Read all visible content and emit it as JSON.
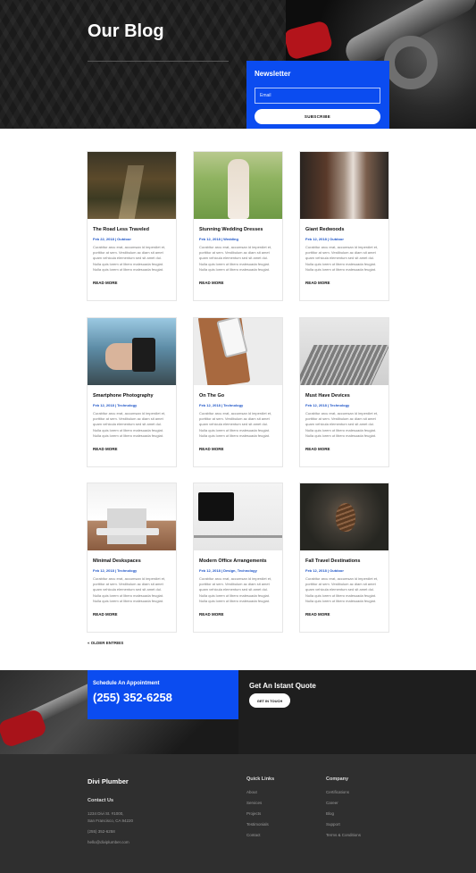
{
  "hero": {
    "title": "Our Blog"
  },
  "newsletter": {
    "title": "Newsletter",
    "email_placeholder": "Email",
    "subscribe_label": "SUBSCRIBE"
  },
  "posts": [
    {
      "title": "The Road Less Traveled",
      "meta": "Feb 22, 2018 | Outdoor",
      "excerpt": "Curabitur arcu erat, accumsan id imperdiet et, porttitor at sem. Vestibulum ac diam sit amet quam vehicula elementum sed sit amet dui. Nulla quis lorem ut libero malesuada feugiat. Nulla quis lorem ut libero malesuada feugiat.",
      "more": "READ MORE"
    },
    {
      "title": "Stunning Wedding Dresses",
      "meta": "Feb 12, 2018 | Wedding",
      "excerpt": "Curabitur arcu erat, accumsan id imperdiet et, porttitor at sem. Vestibulum ac diam sit amet quam vehicula elementum sed sit amet dui. Nulla quis lorem ut libero malesuada feugiat. Nulla quis lorem ut libero malesuada feugiat.",
      "more": "READ MORE"
    },
    {
      "title": "Giant Redwoods",
      "meta": "Feb 12, 2018 | Outdoor",
      "excerpt": "Curabitur arcu erat, accumsan id imperdiet et, porttitor at sem. Vestibulum ac diam sit amet quam vehicula elementum sed sit amet dui. Nulla quis lorem ut libero malesuada feugiat. Nulla quis lorem ut libero malesuada feugiat.",
      "more": "READ MORE"
    },
    {
      "title": "Smartphone Photography",
      "meta": "Feb 12, 2018 | Technology",
      "excerpt": "Curabitur arcu erat, accumsan id imperdiet et, porttitor at sem. Vestibulum ac diam sit amet quam vehicula elementum sed sit amet dui. Nulla quis lorem ut libero malesuada feugiat. Nulla quis lorem ut libero malesuada feugiat.",
      "more": "READ MORE"
    },
    {
      "title": "On The Go",
      "meta": "Feb 12, 2018 | Technology",
      "excerpt": "Curabitur arcu erat, accumsan id imperdiet et, porttitor at sem. Vestibulum ac diam sit amet quam vehicula elementum sed sit amet dui. Nulla quis lorem ut libero malesuada feugiat. Nulla quis lorem ut libero malesuada feugiat.",
      "more": "READ MORE"
    },
    {
      "title": "Must Have Devices",
      "meta": "Feb 12, 2018 | Technology",
      "excerpt": "Curabitur arcu erat, accumsan id imperdiet et, porttitor at sem. Vestibulum ac diam sit amet quam vehicula elementum sed sit amet dui. Nulla quis lorem ut libero malesuada feugiat. Nulla quis lorem ut libero malesuada feugiat.",
      "more": "READ MORE"
    },
    {
      "title": "Minimal Deskspaces",
      "meta": "Feb 12, 2018 | Technology",
      "excerpt": "Curabitur arcu erat, accumsan id imperdiet et, porttitor at sem. Vestibulum ac diam sit amet quam vehicula elementum sed sit amet dui. Nulla quis lorem ut libero malesuada feugiat. Nulla quis lorem ut libero malesuada feugiat.",
      "more": "READ MORE"
    },
    {
      "title": "Modern Office Arrangements",
      "meta": "Feb 12, 2018 | Design, Technology",
      "excerpt": "Curabitur arcu erat, accumsan id imperdiet et, porttitor at sem. Vestibulum ac diam sit amet quam vehicula elementum sed sit amet dui. Nulla quis lorem ut libero malesuada feugiat. Nulla quis lorem ut libero malesuada feugiat.",
      "more": "READ MORE"
    },
    {
      "title": "Fall Travel Destinations",
      "meta": "Feb 12, 2018 | Outdoor",
      "excerpt": "Curabitur arcu erat, accumsan id imperdiet et, porttitor at sem. Vestibulum ac diam sit amet quam vehicula elementum sed sit amet dui. Nulla quis lorem ut libero malesuada feugiat. Nulla quis lorem ut libero malesuada feugiat.",
      "more": "READ MORE"
    }
  ],
  "pagination": {
    "older": "« OLDER ENTRIES"
  },
  "cta": {
    "label": "Schedule An Appointment",
    "phone": "(255) 352-6258",
    "quote_title": "Get An Istant Quote",
    "touch_label": "GET IN TOUCH"
  },
  "footer": {
    "brand": "Divi Plumber",
    "contact_heading": "Contact Us",
    "contact_lines": [
      "1234 Divi St. #1000,",
      "San Francisco, CA 94220",
      "(255) 352-6258",
      "hello@diviplumber.com"
    ],
    "quick_links_heading": "Quick Links",
    "quick_links": [
      "About",
      "Services",
      "Projects",
      "Testimonials",
      "Contact"
    ],
    "company_heading": "Company",
    "company_links": [
      "Certifications",
      "Career",
      "Blog",
      "Support",
      "Terms & Conditions"
    ]
  },
  "colors": {
    "accent": "#0b4cf0",
    "meta": "#1e55c7",
    "dark": "#1e1e1e",
    "footer": "#2f2f2f"
  }
}
